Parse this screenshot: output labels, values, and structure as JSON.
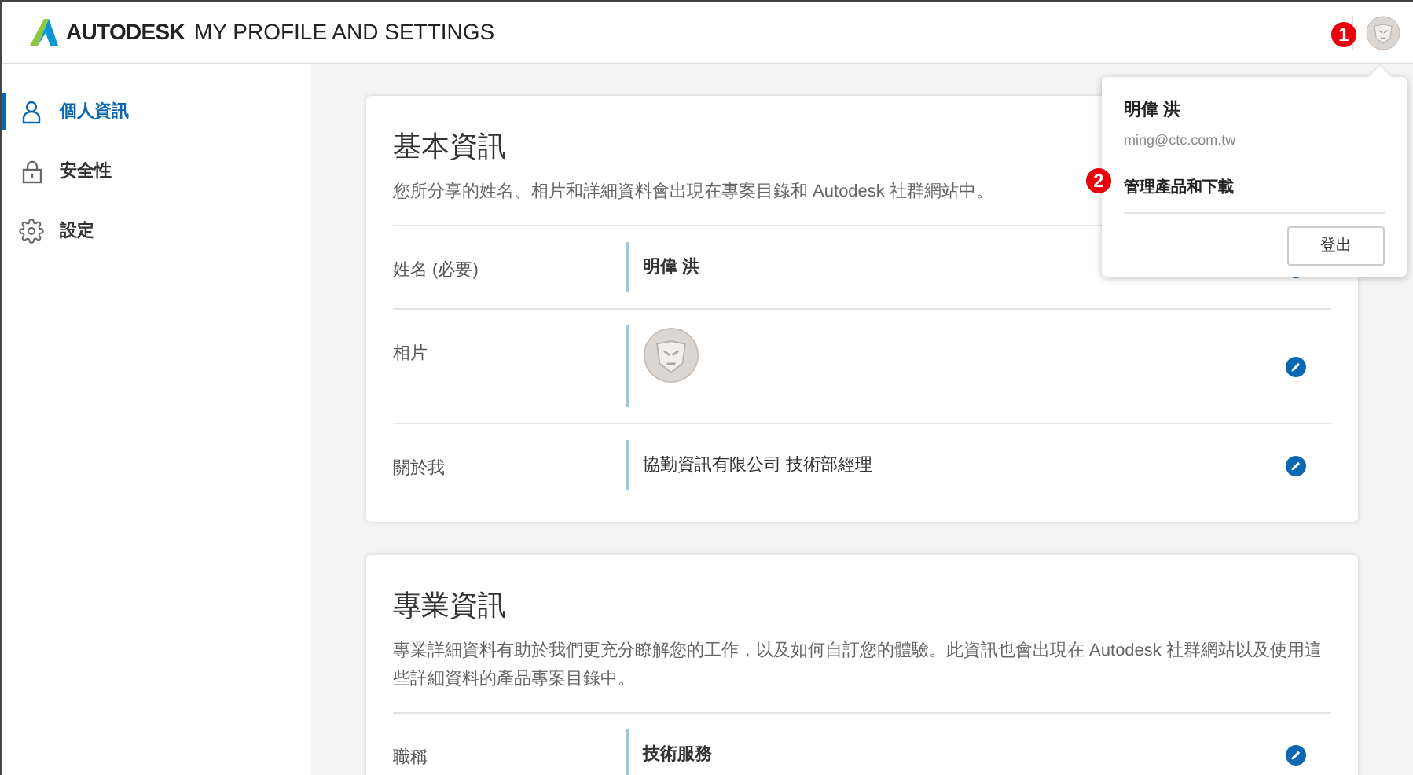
{
  "header": {
    "brand": "AUTODESK",
    "title": "MY PROFILE AND SETTINGS"
  },
  "sidebar": {
    "items": [
      {
        "label": "個人資訊",
        "selected": true
      },
      {
        "label": "安全性",
        "selected": false
      },
      {
        "label": "設定",
        "selected": false
      }
    ]
  },
  "sections": [
    {
      "title": "基本資訊",
      "description": "您所分享的姓名、相片和詳細資料會出現在專案目錄和 Autodesk 社群網站中。",
      "rows": [
        {
          "label": "姓名 (必要)",
          "kind": "text",
          "value": "明偉 洪",
          "bold": true
        },
        {
          "label": "相片",
          "kind": "photo"
        },
        {
          "label": "關於我",
          "kind": "text",
          "value": "協勤資訊有限公司 技術部經理",
          "bold": false
        }
      ]
    },
    {
      "title": "專業資訊",
      "description": "專業詳細資料有助於我們更充分瞭解您的工作，以及如何自訂您的體驗。此資訊也會出現在 Autodesk 社群網站以及使用這些詳細資料的產品專案目錄中。",
      "rows": [
        {
          "label": "職稱",
          "kind": "text",
          "value": "技術服務",
          "bold": true
        }
      ]
    }
  ],
  "account_menu": {
    "name": "明偉 洪",
    "email": "ming@ctc.com.tw",
    "link": "管理產品和下載",
    "button": "登出"
  },
  "callouts": [
    "1",
    "2"
  ]
}
